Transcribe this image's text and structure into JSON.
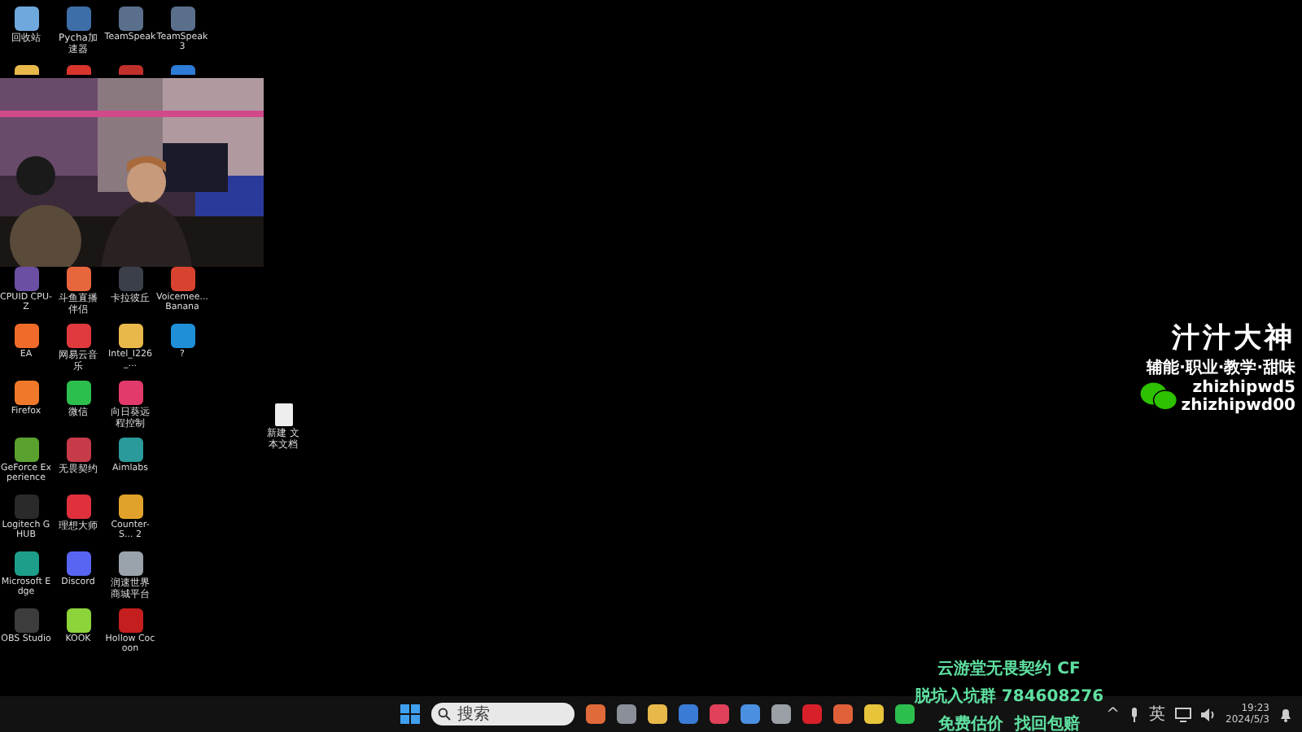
{
  "desktop": {
    "top_rows": [
      [
        {
          "label": "回收站",
          "color": "#6fa8dc"
        },
        {
          "label": "Pycha加速器",
          "color": "#3d6ea8"
        },
        {
          "label": "TeamSpeak",
          "color": "#5a6f8c"
        },
        {
          "label": "TeamSpeak 3",
          "color": "#5a6f8c"
        }
      ],
      [
        {
          "color": "#e8b84a"
        },
        {
          "color": "#d9342b"
        },
        {
          "color": "#c0302a"
        },
        {
          "color": "#2c7bd6"
        }
      ]
    ],
    "rows": [
      [
        {
          "label": "CPUID CPU-Z",
          "color": "#6a4fa3"
        },
        {
          "label": "斗鱼直播伴侣",
          "color": "#e8663d"
        },
        {
          "label": "卡拉彼丘",
          "color": "#3b3f4a"
        },
        {
          "label": "Voicemee... Banana",
          "color": "#d8432f"
        }
      ],
      [
        {
          "label": "EA",
          "color": "#f06b2a"
        },
        {
          "label": "网易云音乐",
          "color": "#e0393e"
        },
        {
          "label": "Intel_I226_...",
          "color": "#e8b84a"
        },
        {
          "label": "?",
          "color": "#1f8fd8"
        }
      ],
      [
        {
          "label": "Firefox",
          "color": "#f0782a"
        },
        {
          "label": "微信",
          "color": "#2dbf4e"
        },
        {
          "label": "向日葵远程控制",
          "color": "#e23a6a"
        }
      ],
      [
        {
          "label": "GeForce Experience",
          "color": "#5aa12f"
        },
        {
          "label": "无畏契约",
          "color": "#c73a4a"
        },
        {
          "label": "Aimlabs",
          "color": "#2a9a9a"
        }
      ],
      [
        {
          "label": "Logitech G HUB",
          "color": "#2a2a2a"
        },
        {
          "label": "理想大师",
          "color": "#e0303c"
        },
        {
          "label": "Counter-S... 2",
          "color": "#e0a22a"
        }
      ],
      [
        {
          "label": "Microsoft Edge",
          "color": "#1d9e8a"
        },
        {
          "label": "Discord",
          "color": "#5865f2"
        },
        {
          "label": "润速世界商城平台",
          "color": "#9aa2ab"
        }
      ],
      [
        {
          "label": "OBS Studio",
          "color": "#3c3c3c"
        },
        {
          "label": "KOOK",
          "color": "#8cd43a"
        },
        {
          "label": "Hollow Cocoon",
          "color": "#c41e1e"
        }
      ]
    ],
    "file": {
      "label": "新建 文本文档"
    }
  },
  "overlay": {
    "title": "汁汁大神",
    "tags": "辅能·职业·教学·甜味",
    "ids": [
      "zhizhipwd5",
      "zhizhipwd00"
    ],
    "ad_lines": [
      "云游堂无畏契约 CF",
      "脱坑入坑群 784608276",
      "免费估价  找回包赔"
    ]
  },
  "taskbar": {
    "search": {
      "placeholder": "搜索"
    },
    "apps": [
      {
        "color": "#e06a3a"
      },
      {
        "color": "#8a8f98"
      },
      {
        "color": "#e8b84a"
      },
      {
        "color": "#3a7bd5"
      },
      {
        "color": "#e0405a"
      },
      {
        "color": "#4a8fe0"
      },
      {
        "color": "#9aa0a6"
      },
      {
        "color": "#d8202a"
      },
      {
        "color": "#e0603a"
      },
      {
        "color": "#e8c43a"
      },
      {
        "color": "#2dbf4e"
      }
    ],
    "tray": {
      "caret": "^",
      "lang": "英",
      "time": "19:23",
      "date": "2024/5/3"
    }
  }
}
